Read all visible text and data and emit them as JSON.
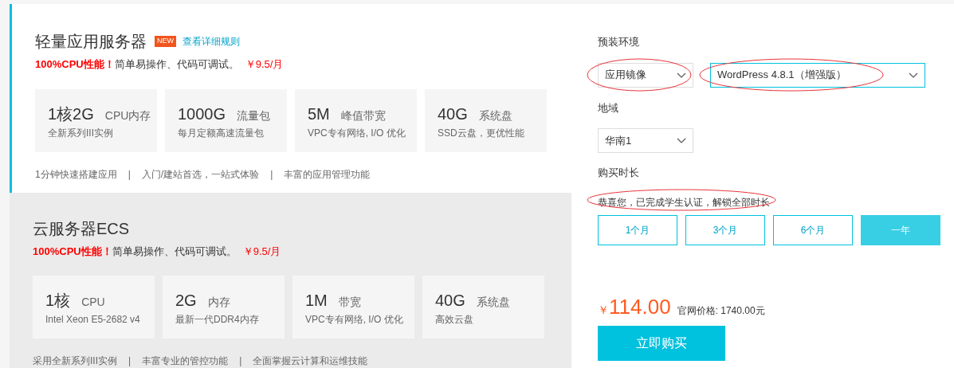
{
  "products": [
    {
      "title": "轻量应用服务器",
      "badge": "NEW",
      "link": "查看详细规则",
      "selected": true,
      "promo": {
        "highlight": "100%CPU性能！",
        "text": "简单易操作、代码可调试。",
        "price": "￥9.5/月"
      },
      "specs": [
        {
          "value": "1核2G",
          "label": "CPU内存",
          "note": "全新系列III实例"
        },
        {
          "value": "1000G",
          "label": "流量包",
          "note": "每月定额高速流量包"
        },
        {
          "value": "5M",
          "label": "峰值带宽",
          "note": "VPC专有网络, I/O 优化"
        },
        {
          "value": "40G",
          "label": "系统盘",
          "note": "SSD云盘，更优性能"
        }
      ],
      "features": [
        "1分钟快速搭建应用",
        "入门/建站首选，一站式体验",
        "丰富的应用管理功能"
      ],
      "separators": [
        "|",
        "|"
      ]
    },
    {
      "title": "云服务器ECS",
      "selected": false,
      "promo": {
        "highlight": "100%CPU性能！",
        "text": "简单易操作、代码可调试。",
        "price": "￥9.5/月"
      },
      "specs": [
        {
          "value": "1核",
          "label": "CPU",
          "note": "Intel Xeon E5-2682 v4"
        },
        {
          "value": "2G",
          "label": "内存",
          "note": "最新一代DDR4内存"
        },
        {
          "value": "1M",
          "label": "带宽",
          "note": "VPC专有网络, I/O 优化"
        },
        {
          "value": "40G",
          "label": "系统盘",
          "note": "高效云盘"
        }
      ],
      "features": [
        "采用全新系列III实例",
        "丰富专业的管控功能",
        "全面掌握云计算和运维技能"
      ],
      "separators": [
        "|",
        "|"
      ]
    }
  ],
  "environment": {
    "label": "预装环境",
    "selects": [
      {
        "value": "应用镜像",
        "focused": false,
        "circled": true
      },
      {
        "value": "WordPress 4.8.1（增强版）",
        "focused": true,
        "circled": true
      }
    ]
  },
  "region": {
    "label": "地域",
    "select": {
      "value": "华南1",
      "focused": false,
      "circled": false
    }
  },
  "duration": {
    "label": "购买时长",
    "notice": "恭喜您，已完成学生认证，解锁全部时长",
    "notice_circled": true,
    "options": [
      {
        "label": "1个月",
        "selected": false
      },
      {
        "label": "3个月",
        "selected": false
      },
      {
        "label": "6个月",
        "selected": false
      },
      {
        "label": "一年",
        "selected": true
      }
    ]
  },
  "price": {
    "currency": "￥",
    "amount": "114.00",
    "list_price": "官网价格: 1740.00元"
  },
  "buy_button": "立即购买"
}
